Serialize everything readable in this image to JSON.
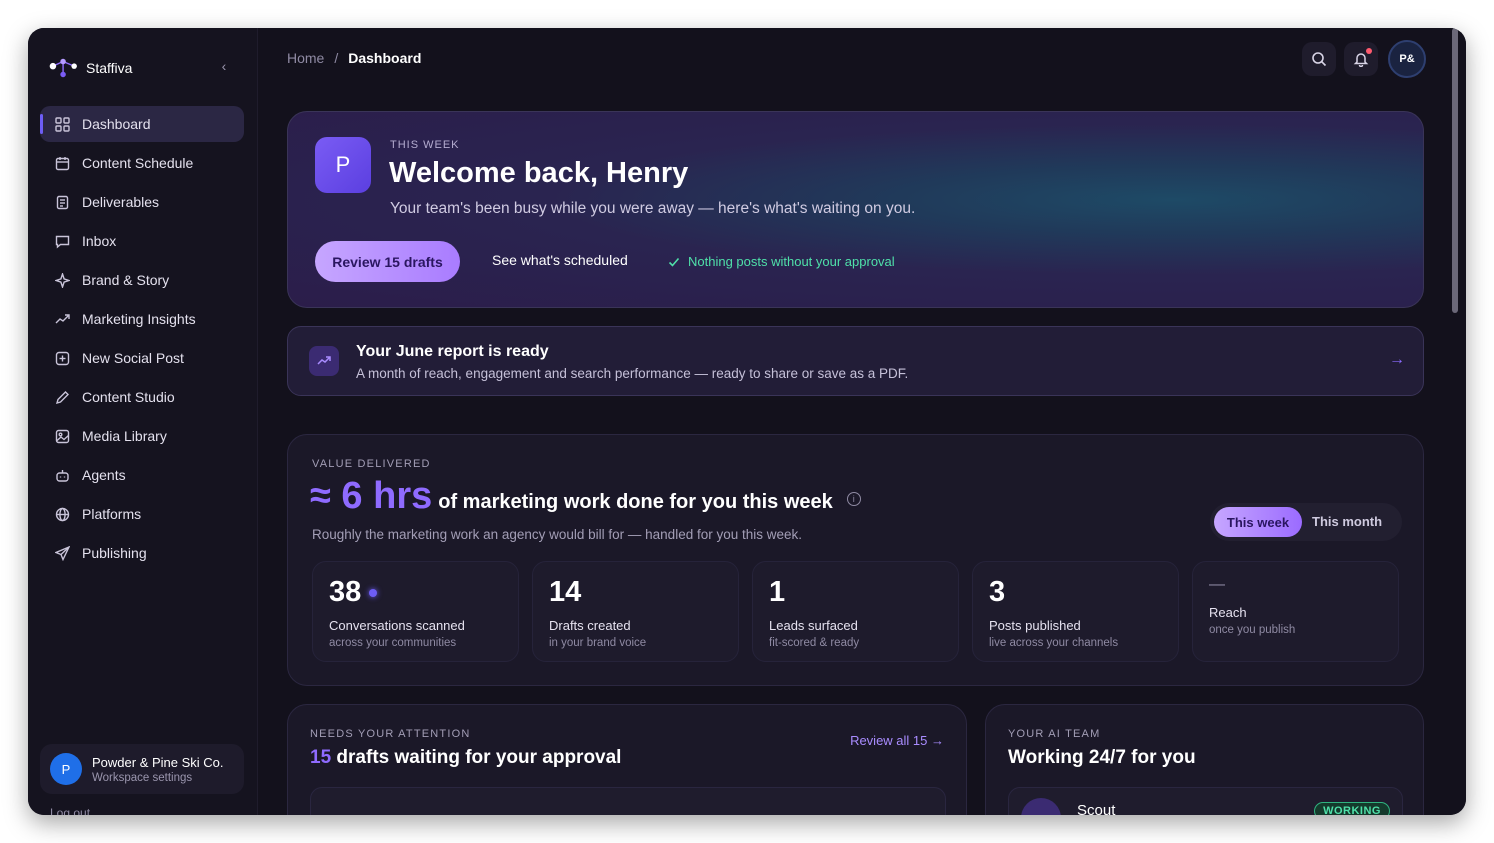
{
  "app": {
    "name": "Staffiva"
  },
  "sidebar": {
    "items": [
      {
        "label": "Dashboard",
        "icon": "grid-icon",
        "active": true
      },
      {
        "label": "Content Schedule",
        "icon": "calendar-icon"
      },
      {
        "label": "Deliverables",
        "icon": "document-icon"
      },
      {
        "label": "Inbox",
        "icon": "chat-icon"
      },
      {
        "label": "Brand & Story",
        "icon": "sparkle-icon"
      },
      {
        "label": "Marketing Insights",
        "icon": "trend-icon"
      },
      {
        "label": "New Social Post",
        "icon": "plus-square-icon"
      },
      {
        "label": "Content Studio",
        "icon": "pencil-icon"
      },
      {
        "label": "Media Library",
        "icon": "image-icon"
      },
      {
        "label": "Agents",
        "icon": "robot-icon"
      },
      {
        "label": "Platforms",
        "icon": "globe-icon"
      },
      {
        "label": "Publishing",
        "icon": "send-icon"
      }
    ],
    "workspace": {
      "initial": "P",
      "name": "Powder & Pine Ski Co.",
      "sub": "Workspace settings"
    },
    "logout": "Log out"
  },
  "topbar": {
    "breadcrumb": {
      "home": "Home",
      "separator": "/",
      "current": "Dashboard"
    },
    "avatar": "P&"
  },
  "hero": {
    "badge": "P",
    "eyebrow": "THIS WEEK",
    "title": "Welcome back, Henry",
    "subtitle": "Your team's been busy while you were away — here's what's waiting on you.",
    "primary_button": "Review 15 drafts",
    "secondary_button": "See what's scheduled",
    "approval_note": "Nothing posts without your approval"
  },
  "report": {
    "title": "Your June report is ready",
    "subtitle": "A month of reach, engagement and search performance — ready to share or save as a PDF."
  },
  "value": {
    "eyebrow": "VALUE DELIVERED",
    "big": "≈ 6 hrs",
    "rest": "of marketing work done for you this week",
    "subtitle": "Roughly the marketing work an agency would bill for — handled for you this week.",
    "toggle": {
      "on": "This week",
      "off": "This month"
    },
    "stats": [
      {
        "num": "38",
        "label": "Conversations scanned",
        "sub": "across your communities"
      },
      {
        "num": "14",
        "label": "Drafts created",
        "sub": "in your brand voice"
      },
      {
        "num": "1",
        "label": "Leads surfaced",
        "sub": "fit-scored & ready"
      },
      {
        "num": "3",
        "label": "Posts published",
        "sub": "live across your channels"
      },
      {
        "num": "—",
        "label": "Reach",
        "sub": "once you publish"
      }
    ]
  },
  "attention": {
    "eyebrow": "NEEDS YOUR ATTENTION",
    "count": "15",
    "title": "drafts waiting for your approval",
    "link": "Review all 15 →"
  },
  "team": {
    "eyebrow": "YOUR AI TEAM",
    "title": "Working 24/7 for you",
    "agent": "Scout",
    "status": "WORKING"
  },
  "colors": {
    "accent": "#8f6bff",
    "success": "#4fe0a9",
    "bg": "#13111c"
  }
}
